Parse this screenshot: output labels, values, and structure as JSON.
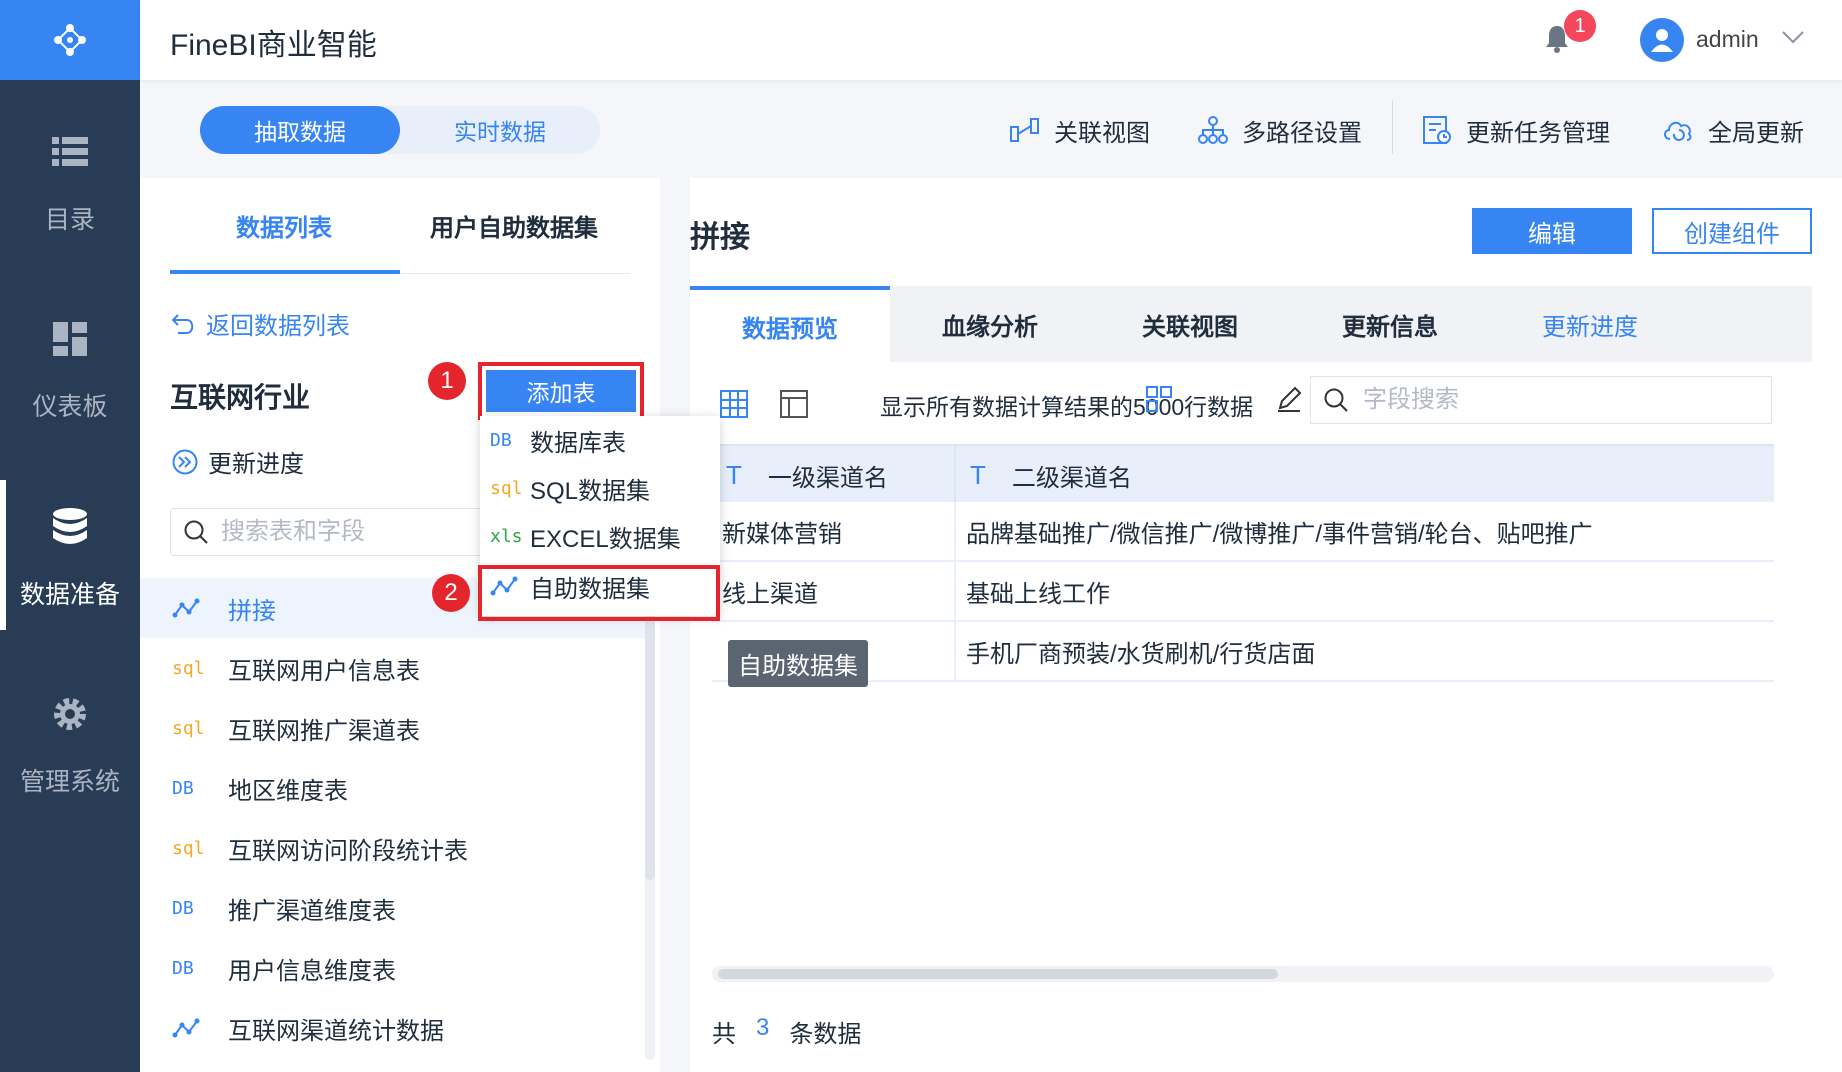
{
  "header": {
    "app_title": "FineBI商业智能",
    "notification_count": "1",
    "username": "admin"
  },
  "nav": [
    {
      "label": "目录",
      "icon": "list-icon"
    },
    {
      "label": "仪表板",
      "icon": "dashboard-icon"
    },
    {
      "label": "数据准备",
      "icon": "database-icon",
      "active": true
    },
    {
      "label": "管理系统",
      "icon": "gear-icon"
    }
  ],
  "mode_toggle": {
    "extract": "抽取数据",
    "realtime": "实时数据",
    "active": "抽取数据"
  },
  "toolbar": {
    "relation_view": "关联视图",
    "multipath": "多路径设置",
    "update_tasks": "更新任务管理",
    "global_update": "全局更新"
  },
  "left_panel": {
    "tabs": [
      "数据列表",
      "用户自助数据集"
    ],
    "active_tab": "数据列表",
    "back_link": "返回数据列表",
    "group_title": "互联网行业",
    "update_progress": "更新进度",
    "search_placeholder": "搜索表和字段",
    "add_table_button": "添加表",
    "tables": [
      {
        "name": "拼接",
        "type": "self-service",
        "active": true
      },
      {
        "name": "互联网用户信息表",
        "type": "sql"
      },
      {
        "name": "互联网推广渠道表",
        "type": "sql"
      },
      {
        "name": "地区维度表",
        "type": "db"
      },
      {
        "name": "互联网访问阶段统计表",
        "type": "sql"
      },
      {
        "name": "推广渠道维度表",
        "type": "db"
      },
      {
        "name": "用户信息维度表",
        "type": "db"
      },
      {
        "name": "互联网渠道统计数据",
        "type": "self-service"
      }
    ],
    "type_labels": {
      "db": "DB",
      "sql": "sql",
      "xls": "xls"
    }
  },
  "dropdown": {
    "items": [
      {
        "label": "数据库表",
        "type": "db"
      },
      {
        "label": "SQL数据集",
        "type": "sql"
      },
      {
        "label": "EXCEL数据集",
        "type": "xls"
      },
      {
        "label": "自助数据集",
        "type": "self-service"
      }
    ]
  },
  "steps": [
    "1",
    "2"
  ],
  "right_panel": {
    "title": "拼接",
    "edit_button": "编辑",
    "create_button": "创建组件",
    "tabs": [
      "数据预览",
      "血缘分析",
      "关联视图",
      "更新信息",
      "更新进度"
    ],
    "active_tab": "数据预览",
    "preview_info": "显示所有数据计算结果的5000行数据",
    "field_search_placeholder": "字段搜索",
    "columns": [
      {
        "type": "T",
        "name": "一级渠道名"
      },
      {
        "type": "T",
        "name": "二级渠道名"
      }
    ],
    "rows": [
      [
        "新媒体营销",
        "品牌基础推广/微信推广/微博推广/事件营销/轮台、贴吧推广"
      ],
      [
        "线上渠道",
        "基础上线工作"
      ],
      [
        "",
        "手机厂商预装/水货刷机/行货店面"
      ]
    ],
    "tooltip": "自助数据集",
    "footer": {
      "prefix": "共",
      "count": "3",
      "suffix": "条数据"
    }
  },
  "colors": {
    "primary": "#3685f2",
    "sidebar": "#293c55",
    "highlight": "#e4262c",
    "badge": "#f5475c"
  }
}
